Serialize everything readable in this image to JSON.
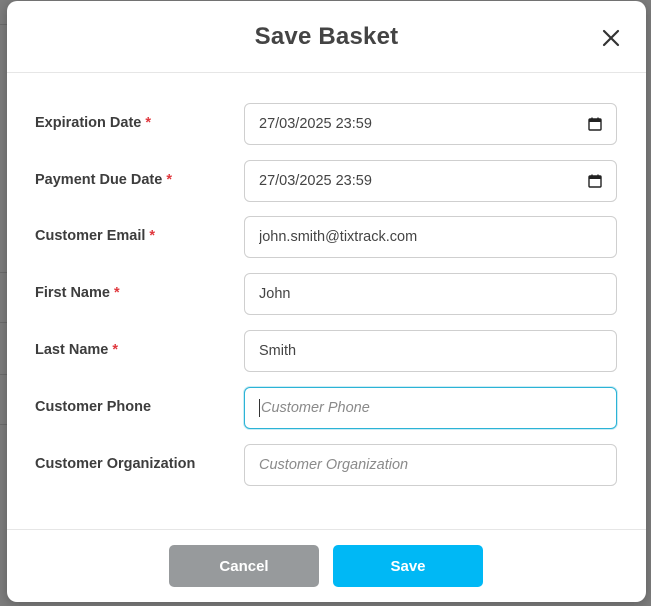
{
  "modal": {
    "title": "Save Basket"
  },
  "form": {
    "fields": [
      {
        "label": "Expiration Date",
        "required": true,
        "type": "datetime",
        "value": "27/03/2025 23:59",
        "placeholder": ""
      },
      {
        "label": "Payment Due Date",
        "required": true,
        "type": "datetime",
        "value": "27/03/2025 23:59",
        "placeholder": ""
      },
      {
        "label": "Customer Email",
        "required": true,
        "type": "text",
        "value": "john.smith@tixtrack.com",
        "placeholder": ""
      },
      {
        "label": "First Name",
        "required": true,
        "type": "text",
        "value": "John",
        "placeholder": ""
      },
      {
        "label": "Last Name",
        "required": true,
        "type": "text",
        "value": "Smith",
        "placeholder": ""
      },
      {
        "label": "Customer Phone",
        "required": false,
        "type": "text",
        "value": "",
        "placeholder": "Customer Phone",
        "focused": true
      },
      {
        "label": "Customer Organization",
        "required": false,
        "type": "text",
        "value": "",
        "placeholder": "Customer Organization"
      }
    ],
    "required_marker": "*"
  },
  "footer": {
    "cancel_label": "Cancel",
    "save_label": "Save"
  },
  "colors": {
    "save_button": "#00b8f5",
    "cancel_button": "#979a9c",
    "required_marker": "#e0383e",
    "focus_border": "#2bb3d6"
  },
  "icons": {
    "close": "close-icon",
    "calendar": "calendar-icon"
  }
}
